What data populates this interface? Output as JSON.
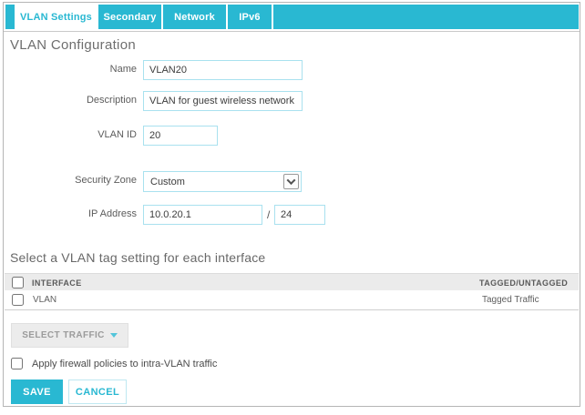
{
  "colors": {
    "teal": "#29b8d2",
    "input_border": "#a9e1ef",
    "table_header_bg": "#ebebeb"
  },
  "tabs": {
    "vlan_settings": "VLAN Settings",
    "secondary": "Secondary",
    "network": "Network",
    "ipv6": "IPv6"
  },
  "heading": "VLAN Configuration",
  "form": {
    "name": {
      "label": "Name",
      "value": "VLAN20"
    },
    "description": {
      "label": "Description",
      "value": "VLAN for guest wireless network"
    },
    "vlan_id": {
      "label": "VLAN ID",
      "value": "20"
    },
    "security_zone": {
      "label": "Security Zone",
      "value": "Custom"
    },
    "ip_address": {
      "label": "IP Address",
      "value": "10.0.20.1",
      "separator": "/",
      "prefix_len": "24"
    }
  },
  "interface_section": {
    "heading": "Select a VLAN tag setting for each interface",
    "columns": {
      "interface": "INTERFACE",
      "tagged": "TAGGED/UNTAGGED"
    },
    "rows": [
      {
        "interface": "VLAN",
        "tagged": "Tagged Traffic"
      }
    ]
  },
  "actions": {
    "select_traffic": "SELECT TRAFFIC",
    "apply_firewall": "Apply firewall policies to intra-VLAN traffic",
    "save": "SAVE",
    "cancel": "CANCEL"
  }
}
